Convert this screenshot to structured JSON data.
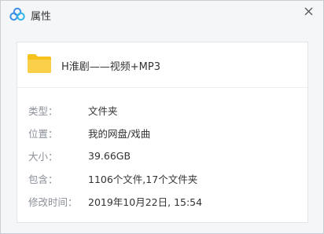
{
  "window": {
    "title": "属性",
    "app_icon": "cloud-logo-icon",
    "close_icon": "close-icon"
  },
  "file": {
    "icon": "folder-icon",
    "name": "H淮剧——视频+MP3"
  },
  "properties": [
    {
      "key": "类型：",
      "value": "文件夹"
    },
    {
      "key": "位置：",
      "value": "我的网盘/戏曲"
    },
    {
      "key": "大小：",
      "value": "39.66GB"
    },
    {
      "key": "包含：",
      "value": "1106个文件,17个文件夹"
    },
    {
      "key": "修改时间：",
      "value": "2019年10月22日, 15:54"
    }
  ],
  "colors": {
    "folder": "#f7c21b",
    "logo_blue": "#3a8ee6",
    "label": "#8b9099",
    "value": "#333333"
  }
}
